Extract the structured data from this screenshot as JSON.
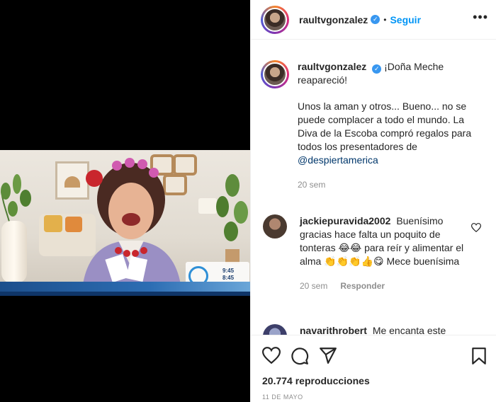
{
  "post": {
    "username": "raultvgonzalez",
    "follow_label": "Seguir",
    "more_icon": "more-horizontal-icon"
  },
  "caption": {
    "username": "raultvgonzalez",
    "text_1": "¡Doña Meche reapareció!",
    "text_2": "Unos la aman y otros... Bueno... no se puede complacer a todo el mundo. La Diva de la Escoba compró regalos para todos los presentadores de",
    "mention": "@despiertamerica",
    "time": "20 sem"
  },
  "comments": [
    {
      "username": "jackiepuravida2002",
      "text": "Buenísimo gracias hace falta un poquito de tonteras 😂😂 para reír y alimentar el alma 👏👏👏👍😋 Mece buenísima",
      "time": "20 sem",
      "reply_label": "Responder"
    },
    {
      "username": "navarithrobert",
      "text": "Me encanta este"
    }
  ],
  "video": {
    "bug_time": "9:45\n8:45"
  },
  "actions": {
    "icons": [
      "heart-icon",
      "comment-icon",
      "share-icon",
      "bookmark-icon"
    ],
    "views": "20.774 reproducciones",
    "date": "11 DE MAYO"
  },
  "colors": {
    "accent": "#0095f6",
    "text": "#262626",
    "muted": "#8e8e8e",
    "mention": "#00376b"
  }
}
